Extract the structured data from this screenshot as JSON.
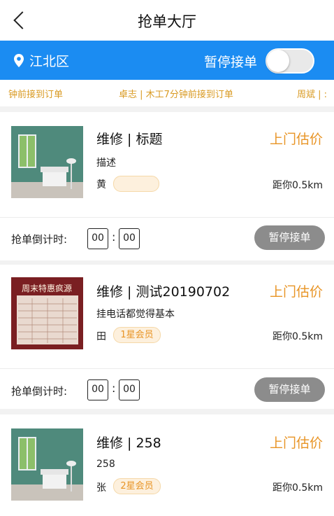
{
  "header": {
    "title": "抢单大厅"
  },
  "location_bar": {
    "district": "江北区",
    "pause_label": "暂停接单",
    "toggle_on": false
  },
  "ticker": [
    "钟前接到订单",
    "卓志 | 木工7分钟前接到订单",
    "周斌 | :"
  ],
  "orders": [
    {
      "title": "维修 | 标题",
      "price_label": "上门估价",
      "description": "描述",
      "surname": "黄",
      "badge": "",
      "distance": "距你0.5km",
      "countdown_label": "抢单倒计时:",
      "minutes": "00",
      "seconds": "00",
      "button": "暂停接单",
      "image": "room-interior"
    },
    {
      "title": "维修 | 测试20190702",
      "price_label": "上门估价",
      "description": "挂电话都觉得基本",
      "surname": "田",
      "badge": "1星会员",
      "distance": "距你0.5km",
      "countdown_label": "抢单倒计时:",
      "minutes": "00",
      "seconds": "00",
      "button": "暂停接单",
      "image": "price-board",
      "image_text": "周末特惠疯源"
    },
    {
      "title": "维修 | 258",
      "price_label": "上门估价",
      "description": "258",
      "surname": "张",
      "badge": "2星会员",
      "distance": "距你0.5km",
      "image": "room-interior"
    }
  ],
  "colors": {
    "primary": "#1b8cf2",
    "accent": "#e89425",
    "ticker": "#d99a22",
    "button_gray": "#8c8c8c"
  }
}
